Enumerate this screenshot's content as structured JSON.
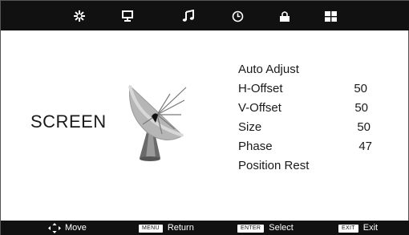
{
  "tabs": [
    {
      "icon": "picture-icon"
    },
    {
      "icon": "screen-icon"
    },
    {
      "icon": "sound-icon"
    },
    {
      "icon": "time-icon"
    },
    {
      "icon": "lock-icon"
    },
    {
      "icon": "setup-icon"
    }
  ],
  "page_title": "SCREEN",
  "menu": [
    {
      "label": "Auto Adjust",
      "value": ""
    },
    {
      "label": "H-Offset",
      "value": "50"
    },
    {
      "label": "V-Offset",
      "value": "50"
    },
    {
      "label": "Size",
      "value": "50"
    },
    {
      "label": "Phase",
      "value": "47"
    },
    {
      "label": "Position Rest",
      "value": ""
    }
  ],
  "footer": {
    "move_label": "Move",
    "menu_key": "MENU",
    "return_label": "Return",
    "enter_key": "ENTER",
    "select_label": "Select",
    "exit_key": "EXIT",
    "exit_label": "Exit"
  },
  "colors": {
    "bar": "#111111",
    "background": "#ffffff",
    "text": "#1a1a1a"
  }
}
